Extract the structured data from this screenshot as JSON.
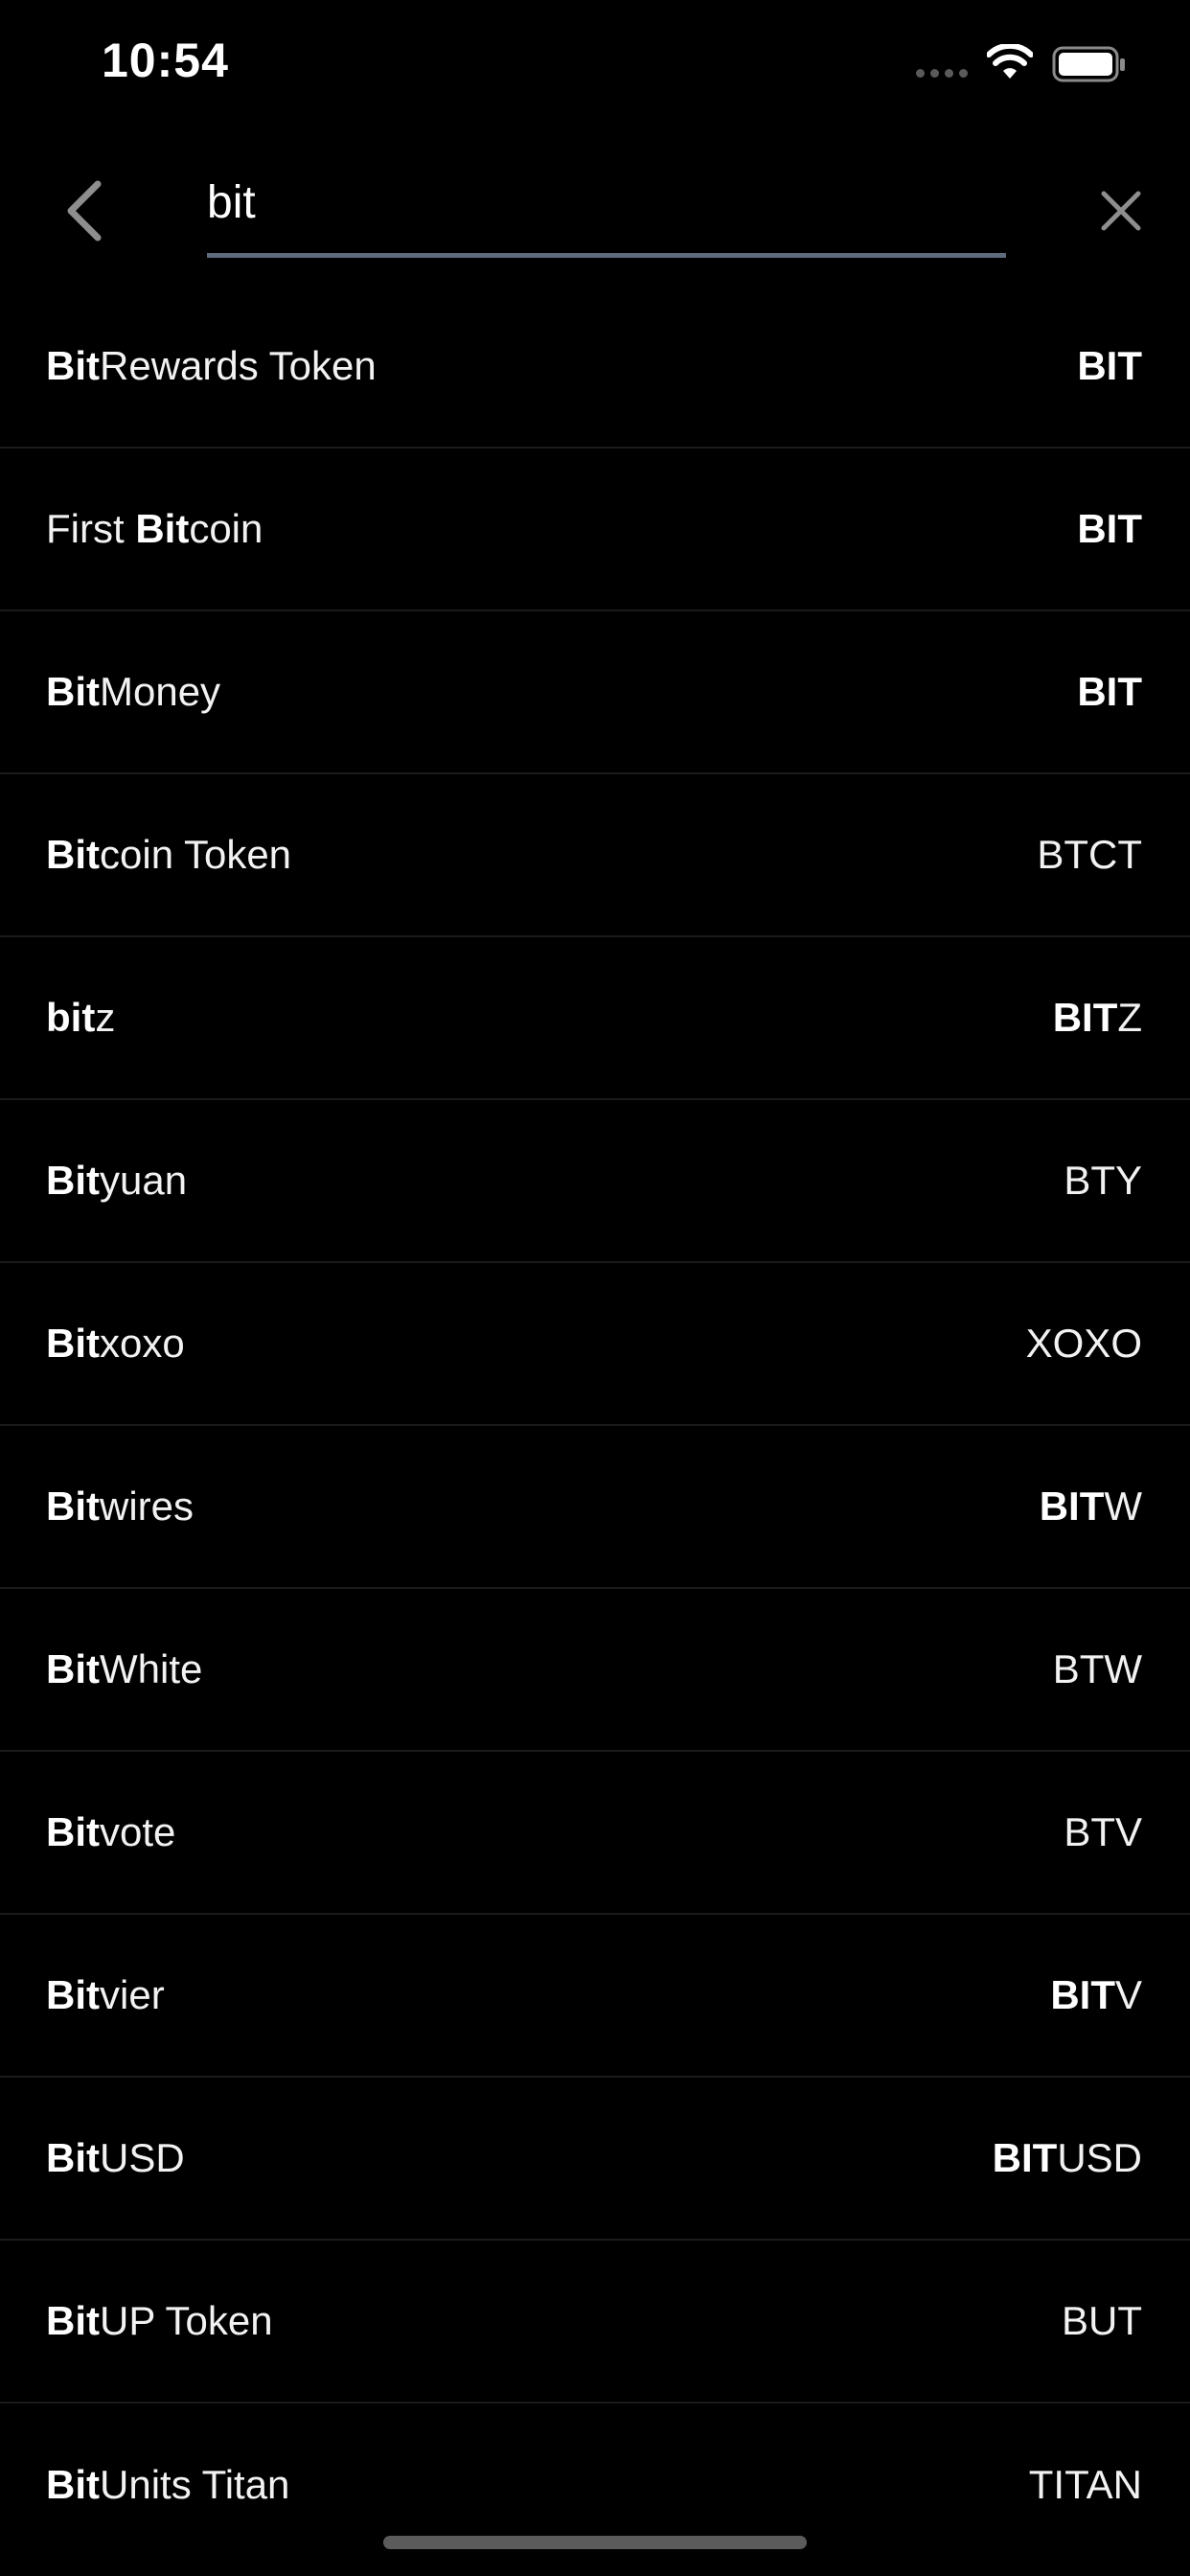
{
  "status_bar": {
    "time": "10:54",
    "signal_icon": "cellular-dots-icon",
    "wifi_icon": "wifi-icon",
    "battery_icon": "battery-icon"
  },
  "search": {
    "back_icon": "chevron-left-icon",
    "query": "bit",
    "clear_icon": "close-icon",
    "underline_color": "#5d6b7d"
  },
  "results": [
    {
      "name_parts": [
        {
          "text": "Bit",
          "bold": true
        },
        {
          "text": "Rewards Token",
          "bold": false
        }
      ],
      "symbol_parts": [
        {
          "text": "BIT",
          "bold": true
        }
      ]
    },
    {
      "name_parts": [
        {
          "text": "First ",
          "bold": false
        },
        {
          "text": "Bit",
          "bold": true
        },
        {
          "text": "coin",
          "bold": false
        }
      ],
      "symbol_parts": [
        {
          "text": "BIT",
          "bold": true
        }
      ]
    },
    {
      "name_parts": [
        {
          "text": "Bit",
          "bold": true
        },
        {
          "text": "Money",
          "bold": false
        }
      ],
      "symbol_parts": [
        {
          "text": "BIT",
          "bold": true
        }
      ]
    },
    {
      "name_parts": [
        {
          "text": "Bit",
          "bold": true
        },
        {
          "text": "coin Token",
          "bold": false
        }
      ],
      "symbol_parts": [
        {
          "text": "BTCT",
          "bold": false
        }
      ]
    },
    {
      "name_parts": [
        {
          "text": "bit",
          "bold": true
        },
        {
          "text": "z",
          "bold": false
        }
      ],
      "symbol_parts": [
        {
          "text": "BIT",
          "bold": true
        },
        {
          "text": "Z",
          "bold": false
        }
      ]
    },
    {
      "name_parts": [
        {
          "text": "Bit",
          "bold": true
        },
        {
          "text": "yuan",
          "bold": false
        }
      ],
      "symbol_parts": [
        {
          "text": "BTY",
          "bold": false
        }
      ]
    },
    {
      "name_parts": [
        {
          "text": "Bit",
          "bold": true
        },
        {
          "text": "xoxo",
          "bold": false
        }
      ],
      "symbol_parts": [
        {
          "text": "XOXO",
          "bold": false
        }
      ]
    },
    {
      "name_parts": [
        {
          "text": "Bit",
          "bold": true
        },
        {
          "text": "wires",
          "bold": false
        }
      ],
      "symbol_parts": [
        {
          "text": "BIT",
          "bold": true
        },
        {
          "text": "W",
          "bold": false
        }
      ]
    },
    {
      "name_parts": [
        {
          "text": "Bit",
          "bold": true
        },
        {
          "text": "White",
          "bold": false
        }
      ],
      "symbol_parts": [
        {
          "text": "BTW",
          "bold": false
        }
      ]
    },
    {
      "name_parts": [
        {
          "text": "Bit",
          "bold": true
        },
        {
          "text": "vote",
          "bold": false
        }
      ],
      "symbol_parts": [
        {
          "text": "BTV",
          "bold": false
        }
      ]
    },
    {
      "name_parts": [
        {
          "text": "Bit",
          "bold": true
        },
        {
          "text": "vier",
          "bold": false
        }
      ],
      "symbol_parts": [
        {
          "text": "BIT",
          "bold": true
        },
        {
          "text": "V",
          "bold": false
        }
      ]
    },
    {
      "name_parts": [
        {
          "text": "Bit",
          "bold": true
        },
        {
          "text": "USD",
          "bold": false
        }
      ],
      "symbol_parts": [
        {
          "text": "BIT",
          "bold": true
        },
        {
          "text": "USD",
          "bold": false
        }
      ]
    },
    {
      "name_parts": [
        {
          "text": "Bit",
          "bold": true
        },
        {
          "text": "UP Token",
          "bold": false
        }
      ],
      "symbol_parts": [
        {
          "text": "BUT",
          "bold": false
        }
      ]
    },
    {
      "name_parts": [
        {
          "text": "Bit",
          "bold": true
        },
        {
          "text": "Units Titan",
          "bold": false
        }
      ],
      "symbol_parts": [
        {
          "text": "TITAN",
          "bold": false
        }
      ]
    }
  ]
}
